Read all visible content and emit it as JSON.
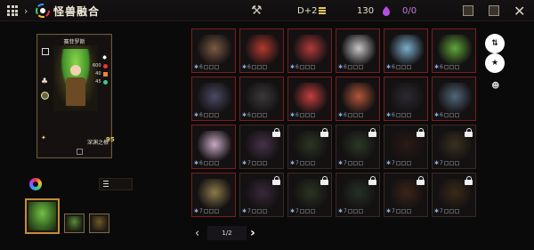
{
  "header": {
    "title": "怪兽融合",
    "level_label": "D+2",
    "gold": "130",
    "collection_count": "0/0"
  },
  "detail": {
    "name": "赛菲罗斯",
    "stats": {
      "atk": "600",
      "def": "40",
      "spd": "45"
    },
    "skill_name": "深渊之根",
    "skill_level": "95"
  },
  "grid": {
    "cells": [
      {
        "level": "6",
        "locked": false,
        "color": "#7a5a44"
      },
      {
        "level": "6",
        "locked": false,
        "color": "#b23a2e"
      },
      {
        "level": "6",
        "locked": false,
        "color": "#b13a3a"
      },
      {
        "level": "6",
        "locked": false,
        "color": "#c8c8c8"
      },
      {
        "level": "6",
        "locked": false,
        "color": "#7ab0cc"
      },
      {
        "level": "6",
        "locked": false,
        "color": "#5ea63a"
      },
      {
        "level": "6",
        "locked": false,
        "color": "#4a4a64"
      },
      {
        "level": "6",
        "locked": false,
        "color": "#3a3a3a"
      },
      {
        "level": "6",
        "locked": false,
        "color": "#c43e3e"
      },
      {
        "level": "6",
        "locked": false,
        "color": "#b2573a"
      },
      {
        "level": "6",
        "locked": false,
        "color": "#2a2a30"
      },
      {
        "level": "6",
        "locked": false,
        "color": "#506878"
      },
      {
        "level": "6",
        "locked": false,
        "color": "#c8a8c4"
      },
      {
        "level": "7",
        "locked": true,
        "color": "#46324a"
      },
      {
        "level": "7",
        "locked": true,
        "color": "#2a3622"
      },
      {
        "level": "7",
        "locked": true,
        "color": "#2a3826"
      },
      {
        "level": "7",
        "locked": true,
        "color": "#2a1a14"
      },
      {
        "level": "7",
        "locked": true,
        "color": "#3a3020"
      },
      {
        "level": "7",
        "locked": false,
        "color": "#8a7a4a"
      },
      {
        "level": "7",
        "locked": true,
        "color": "#38283a"
      },
      {
        "level": "7",
        "locked": true,
        "color": "#2a3420"
      },
      {
        "level": "7",
        "locked": true,
        "color": "#243224"
      },
      {
        "level": "7",
        "locked": true,
        "color": "#3a2418"
      },
      {
        "level": "7",
        "locked": true,
        "color": "#3a2a18"
      }
    ]
  },
  "pager": {
    "label": "1/2"
  },
  "colors": {
    "accent": "#c58a3a",
    "owned_border": "#7a1e1e"
  }
}
